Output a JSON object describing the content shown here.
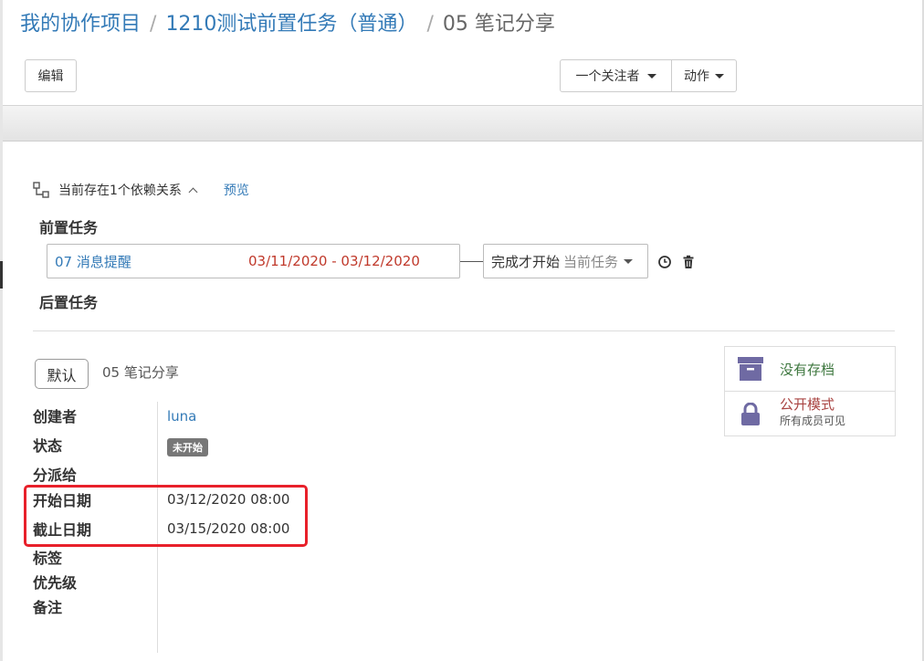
{
  "breadcrumb": {
    "items": [
      "我的协作项目",
      "1210测试前置任务（普通）"
    ],
    "separator": "/",
    "current": "05 笔记分享"
  },
  "toolbar": {
    "edit_label": "编辑",
    "follower_label": "一个关注者",
    "action_label": "动作"
  },
  "dependency": {
    "summary": "当前存在1个依赖关系",
    "preview_label": "预览",
    "predecessor_title": "前置任务",
    "successor_title": "后置任务",
    "predecessor": {
      "name": "07 消息提醒",
      "date_range": "03/11/2020 - 03/12/2020",
      "relation": "完成才开始",
      "relation_target": "当前任务"
    }
  },
  "task": {
    "default_label": "默认",
    "title": "05 笔记分享",
    "fields": {
      "creator_label": "创建者",
      "creator_value": "luna",
      "status_label": "状态",
      "status_value": "未开始",
      "assignee_label": "分派给",
      "start_label": "开始日期",
      "start_value": "03/12/2020 08:00",
      "due_label": "截止日期",
      "due_value": "03/15/2020 08:00",
      "tags_label": "标签",
      "priority_label": "优先级",
      "notes_label": "备注"
    }
  },
  "status_panel": {
    "archive_label": "没有存档",
    "visibility_label": "公开模式",
    "visibility_desc": "所有成员可见"
  },
  "colors": {
    "link": "#337ab7",
    "date_red": "#c0392b",
    "archive_green": "#3c763d",
    "public_red": "#a94442",
    "icon_purple": "#6f6aa3",
    "highlight": "#e8202a"
  }
}
